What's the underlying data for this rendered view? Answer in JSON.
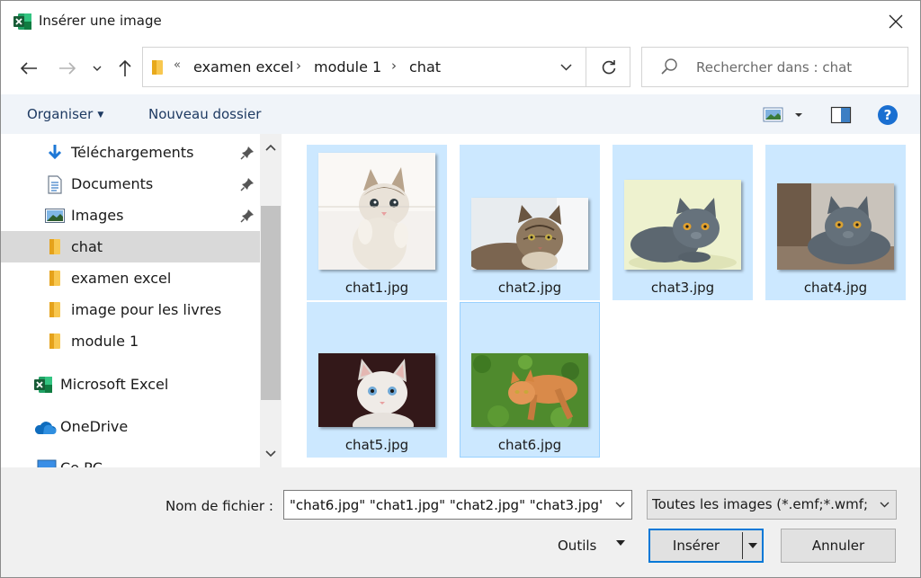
{
  "window": {
    "title": "Insérer une image",
    "app_icon": "excel-icon",
    "close_icon": "close-icon"
  },
  "navigation": {
    "back_icon": "arrow-left-icon",
    "forward_icon": "arrow-right-icon",
    "recent_icon": "chevron-down-icon",
    "up_icon": "arrow-up-icon"
  },
  "address": {
    "overflow": "«",
    "crumbs": [
      "examen excel",
      "module 1",
      "chat"
    ],
    "refresh_icon": "refresh-icon"
  },
  "search": {
    "placeholder": "Rechercher dans : chat",
    "value": ""
  },
  "toolbar": {
    "organise_label": "Organiser",
    "new_folder_label": "Nouveau dossier",
    "view_icon": "view-thumbnails-icon",
    "preview_icon": "preview-pane-icon",
    "help_icon": "help-icon"
  },
  "sidebar": {
    "items": [
      {
        "label": "Téléchargements",
        "icon": "download-arrow-icon",
        "pinned": true
      },
      {
        "label": "Documents",
        "icon": "documents-icon",
        "pinned": true
      },
      {
        "label": "Images",
        "icon": "pictures-icon",
        "pinned": true
      },
      {
        "label": "chat",
        "icon": "folder-icon",
        "pinned": false,
        "selected": true
      },
      {
        "label": "examen excel",
        "icon": "folder-icon",
        "pinned": false
      },
      {
        "label": "image pour les livres",
        "icon": "folder-icon",
        "pinned": false
      },
      {
        "label": "module 1",
        "icon": "folder-icon",
        "pinned": false
      },
      {
        "label": "Microsoft Excel",
        "icon": "excel-icon",
        "pinned": false
      },
      {
        "label": "OneDrive",
        "icon": "cloud-icon",
        "pinned": false
      },
      {
        "label": "Ce PC",
        "icon": "computer-icon",
        "pinned": false
      }
    ]
  },
  "files": [
    {
      "name": "chat1.jpg",
      "selected": true
    },
    {
      "name": "chat2.jpg",
      "selected": true
    },
    {
      "name": "chat3.jpg",
      "selected": true
    },
    {
      "name": "chat4.jpg",
      "selected": true
    },
    {
      "name": "chat5.jpg",
      "selected": true
    },
    {
      "name": "chat6.jpg",
      "selected": true,
      "focused": true
    }
  ],
  "footer": {
    "filename_label": "Nom de fichier :",
    "filename_value": "\"chat6.jpg\" \"chat1.jpg\" \"chat2.jpg\" \"chat3.jpg\"",
    "filetype_value": "Toutes les images (*.emf;*.wmf;",
    "tools_label": "Outils",
    "insert_label": "Insérer",
    "cancel_label": "Annuler"
  },
  "colors": {
    "selection": "#cce8ff",
    "focus_border": "#99d1ff",
    "toolbar_bg": "#f0f4f9",
    "accent": "#0078d7",
    "excel_green": "#1d6f42"
  }
}
